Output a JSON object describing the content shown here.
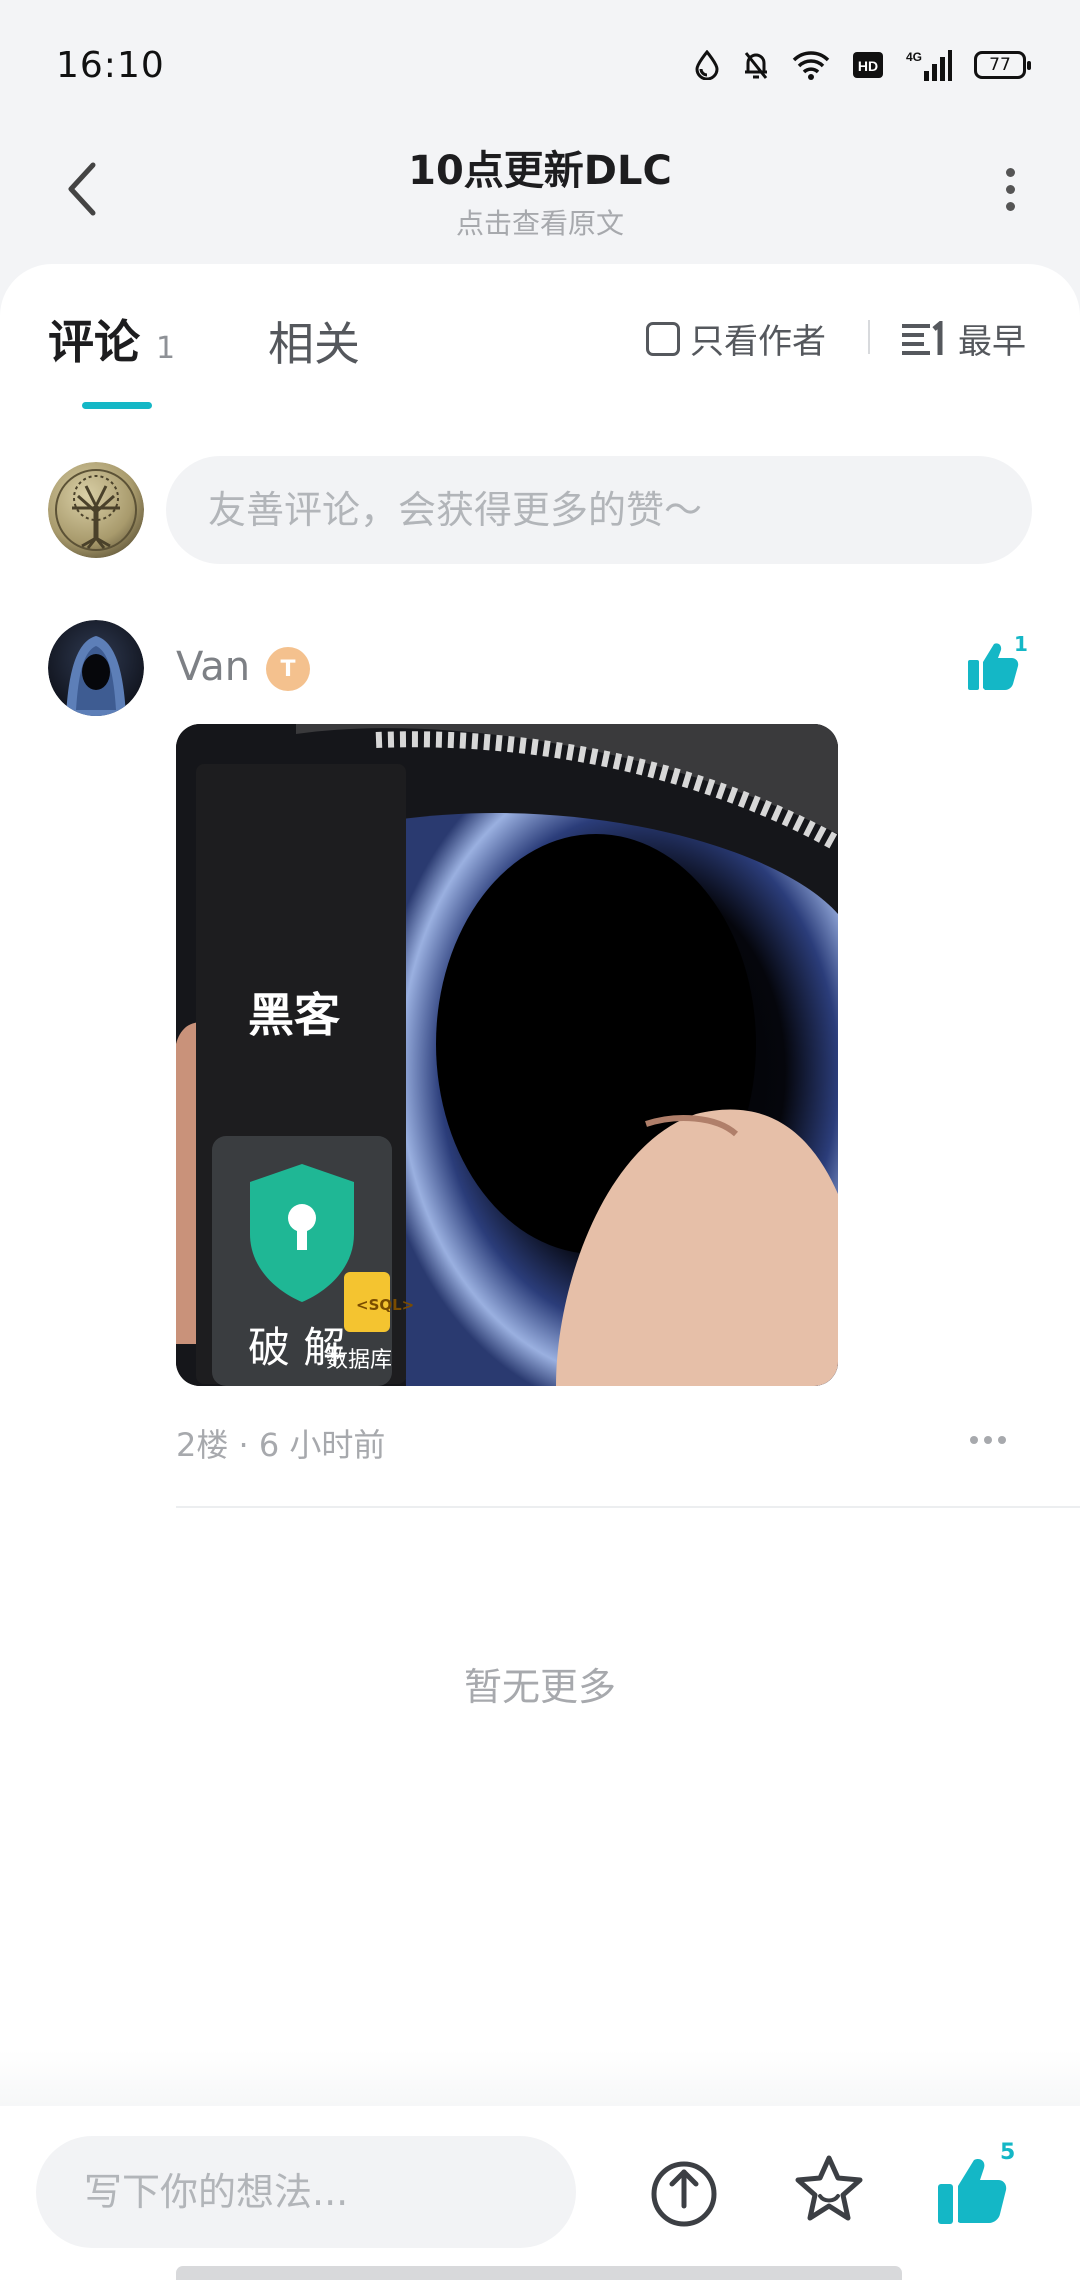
{
  "status_bar": {
    "time": "16:10",
    "network": "4G",
    "hd": "HD",
    "battery": "77"
  },
  "header": {
    "title": "10点更新DLC",
    "subtitle": "点击查看原文"
  },
  "tabs": {
    "comments_label": "评论",
    "comments_count": "1",
    "related_label": "相关",
    "author_only_label": "只看作者",
    "sort_label": "最早",
    "active_color": "#14b7c6"
  },
  "comment_input": {
    "placeholder": "友善评论，会获得更多的赞～"
  },
  "comments": [
    {
      "author": "Van",
      "badge": "T",
      "likes": "1",
      "image_text": {
        "hacker": "黑客",
        "crack": "破 解",
        "database": "数据库",
        "sql": "<SQL>"
      },
      "meta": "2楼 · 6 小时前"
    }
  ],
  "list_end": "暂无更多",
  "bottom_bar": {
    "placeholder": "写下你的想法...",
    "like_count": "5"
  },
  "icons": {
    "back": "chevron-left-icon",
    "more": "more-vertical-icon",
    "sort": "sort-list-icon",
    "share": "share-icon",
    "favorite": "star-icon",
    "like": "thumbs-up-icon"
  },
  "colors": {
    "accent": "#14b7c6",
    "background": "#f3f4f6"
  }
}
